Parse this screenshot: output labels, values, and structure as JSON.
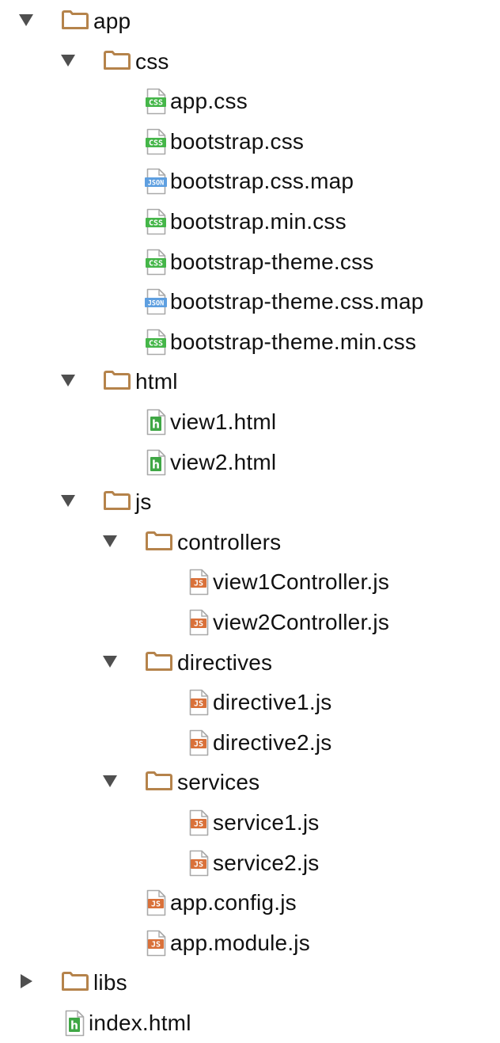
{
  "colors": {
    "folder": "#b5834b",
    "css_badge": "#45b649",
    "json_badge": "#5e9fe0",
    "js_badge": "#d9713a",
    "html_badge": "#3fa745",
    "arrow": "#4f4f4f"
  },
  "tree": [
    {
      "depth": 0,
      "kind": "folder",
      "expanded": true,
      "label": "app",
      "icon": "folder-icon"
    },
    {
      "depth": 1,
      "kind": "folder",
      "expanded": true,
      "label": "css",
      "icon": "folder-icon"
    },
    {
      "depth": 2,
      "kind": "file",
      "label": "app.css",
      "icon": "css-file-icon",
      "badge": "CSS"
    },
    {
      "depth": 2,
      "kind": "file",
      "label": "bootstrap.css",
      "icon": "css-file-icon",
      "badge": "CSS"
    },
    {
      "depth": 2,
      "kind": "file",
      "label": "bootstrap.css.map",
      "icon": "json-file-icon",
      "badge": "JSON"
    },
    {
      "depth": 2,
      "kind": "file",
      "label": "bootstrap.min.css",
      "icon": "css-file-icon",
      "badge": "CSS"
    },
    {
      "depth": 2,
      "kind": "file",
      "label": "bootstrap-theme.css",
      "icon": "css-file-icon",
      "badge": "CSS"
    },
    {
      "depth": 2,
      "kind": "file",
      "label": "bootstrap-theme.css.map",
      "icon": "json-file-icon",
      "badge": "JSON"
    },
    {
      "depth": 2,
      "kind": "file",
      "label": "bootstrap-theme.min.css",
      "icon": "css-file-icon",
      "badge": "CSS"
    },
    {
      "depth": 1,
      "kind": "folder",
      "expanded": true,
      "label": "html",
      "icon": "folder-icon"
    },
    {
      "depth": 2,
      "kind": "file",
      "label": "view1.html",
      "icon": "html-file-icon",
      "badge": "h"
    },
    {
      "depth": 2,
      "kind": "file",
      "label": "view2.html",
      "icon": "html-file-icon",
      "badge": "h"
    },
    {
      "depth": 1,
      "kind": "folder",
      "expanded": true,
      "label": "js",
      "icon": "folder-icon"
    },
    {
      "depth": 2,
      "kind": "folder",
      "expanded": true,
      "label": "controllers",
      "icon": "folder-icon"
    },
    {
      "depth": 3,
      "kind": "file",
      "label": "view1Controller.js",
      "icon": "js-file-icon",
      "badge": "JS"
    },
    {
      "depth": 3,
      "kind": "file",
      "label": "view2Controller.js",
      "icon": "js-file-icon",
      "badge": "JS"
    },
    {
      "depth": 2,
      "kind": "folder",
      "expanded": true,
      "label": "directives",
      "icon": "folder-icon"
    },
    {
      "depth": 3,
      "kind": "file",
      "label": "directive1.js",
      "icon": "js-file-icon",
      "badge": "JS"
    },
    {
      "depth": 3,
      "kind": "file",
      "label": "directive2.js",
      "icon": "js-file-icon",
      "badge": "JS"
    },
    {
      "depth": 2,
      "kind": "folder",
      "expanded": true,
      "label": "services",
      "icon": "folder-icon"
    },
    {
      "depth": 3,
      "kind": "file",
      "label": "service1.js",
      "icon": "js-file-icon",
      "badge": "JS"
    },
    {
      "depth": 3,
      "kind": "file",
      "label": "service2.js",
      "icon": "js-file-icon",
      "badge": "JS"
    },
    {
      "depth": 2,
      "kind": "file",
      "label": "app.config.js",
      "icon": "js-file-icon",
      "badge": "JS"
    },
    {
      "depth": 2,
      "kind": "file",
      "label": "app.module.js",
      "icon": "js-file-icon",
      "badge": "JS"
    },
    {
      "depth": 0,
      "kind": "folder",
      "expanded": false,
      "label": "libs",
      "icon": "folder-icon"
    },
    {
      "depth": 0,
      "kind": "file",
      "label": "index.html",
      "icon": "html-file-icon",
      "badge": "h"
    }
  ]
}
